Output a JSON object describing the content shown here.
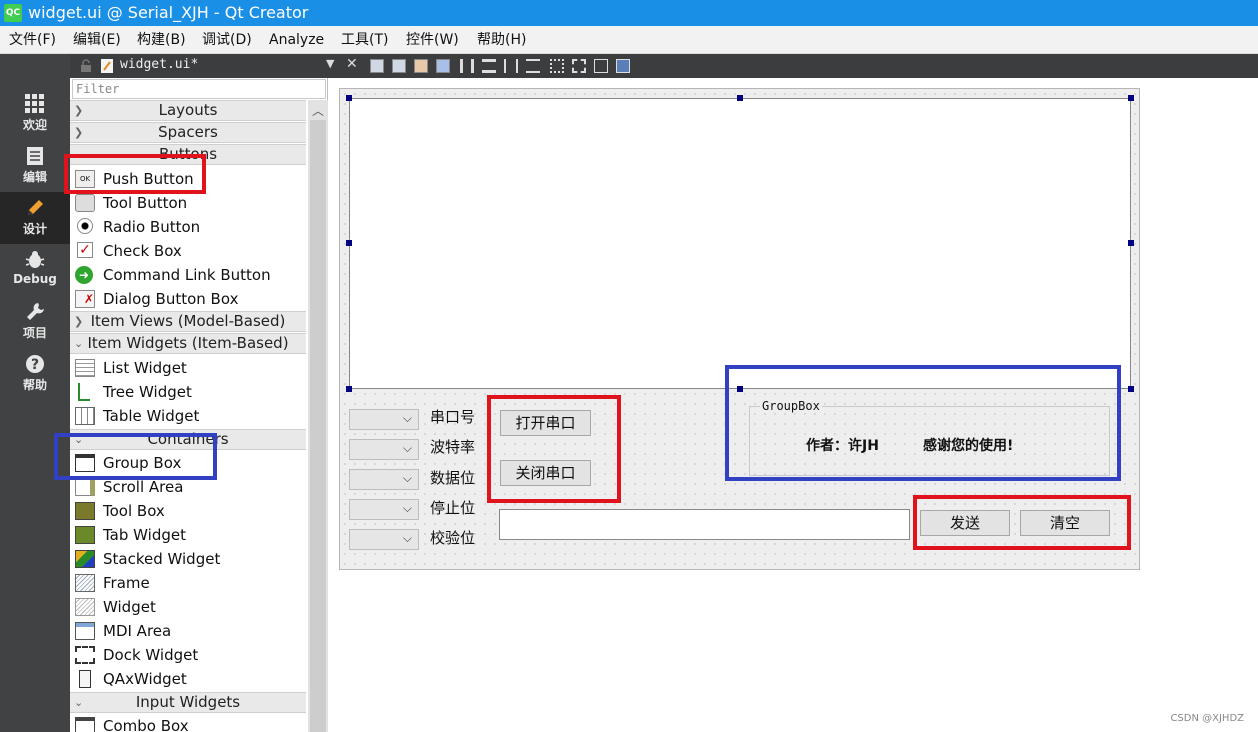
{
  "window": {
    "title": "widget.ui @ Serial_XJH - Qt Creator",
    "logo": "QC"
  },
  "menu": [
    "文件(F)",
    "编辑(E)",
    "构建(B)",
    "调试(D)",
    "Analyze",
    "工具(T)",
    "控件(W)",
    "帮助(H)"
  ],
  "modes": [
    {
      "label": "欢迎",
      "icon": "grid-icon"
    },
    {
      "label": "编辑",
      "icon": "document-icon"
    },
    {
      "label": "设计",
      "icon": "pencil-icon",
      "active": true
    },
    {
      "label": "Debug",
      "icon": "bug-icon"
    },
    {
      "label": "项目",
      "icon": "wrench-icon"
    },
    {
      "label": "帮助",
      "icon": "help-icon"
    }
  ],
  "doc_tab": {
    "filename": "widget.ui*"
  },
  "widget_box": {
    "filter_placeholder": "Filter",
    "categories": {
      "layouts": "Layouts",
      "spacers": "Spacers",
      "buttons": "Buttons",
      "item_views": "Item Views (Model-Based)",
      "item_widgets": "Item Widgets (Item-Based)",
      "containers": "Containers",
      "input_widgets": "Input Widgets"
    },
    "button_items": [
      "Push Button",
      "Tool Button",
      "Radio Button",
      "Check Box",
      "Command Link Button",
      "Dialog Button Box"
    ],
    "item_widget_items": [
      "List Widget",
      "Tree Widget",
      "Table Widget"
    ],
    "container_items": [
      "Group Box",
      "Scroll Area",
      "Tool Box",
      "Tab Widget",
      "Stacked Widget",
      "Frame",
      "Widget",
      "MDI Area",
      "Dock Widget",
      "QAxWidget"
    ],
    "input_items": [
      "Combo Box"
    ]
  },
  "form": {
    "labels": [
      "串口号",
      "波特率",
      "数据位",
      "停止位",
      "校验位"
    ],
    "open_button": "打开串口",
    "close_button": "关闭串口",
    "groupbox_title": "GroupBox",
    "author_text": "作者：许JH",
    "thanks_text": "感谢您的使用!",
    "send_button": "发送",
    "clear_button": "清空"
  },
  "colors": {
    "highlight_red": "#e0131d",
    "highlight_blue": "#3240c4",
    "title_bar": "#1a8fe6",
    "handle": "#000080"
  },
  "watermark": "CSDN @XJHDZ"
}
